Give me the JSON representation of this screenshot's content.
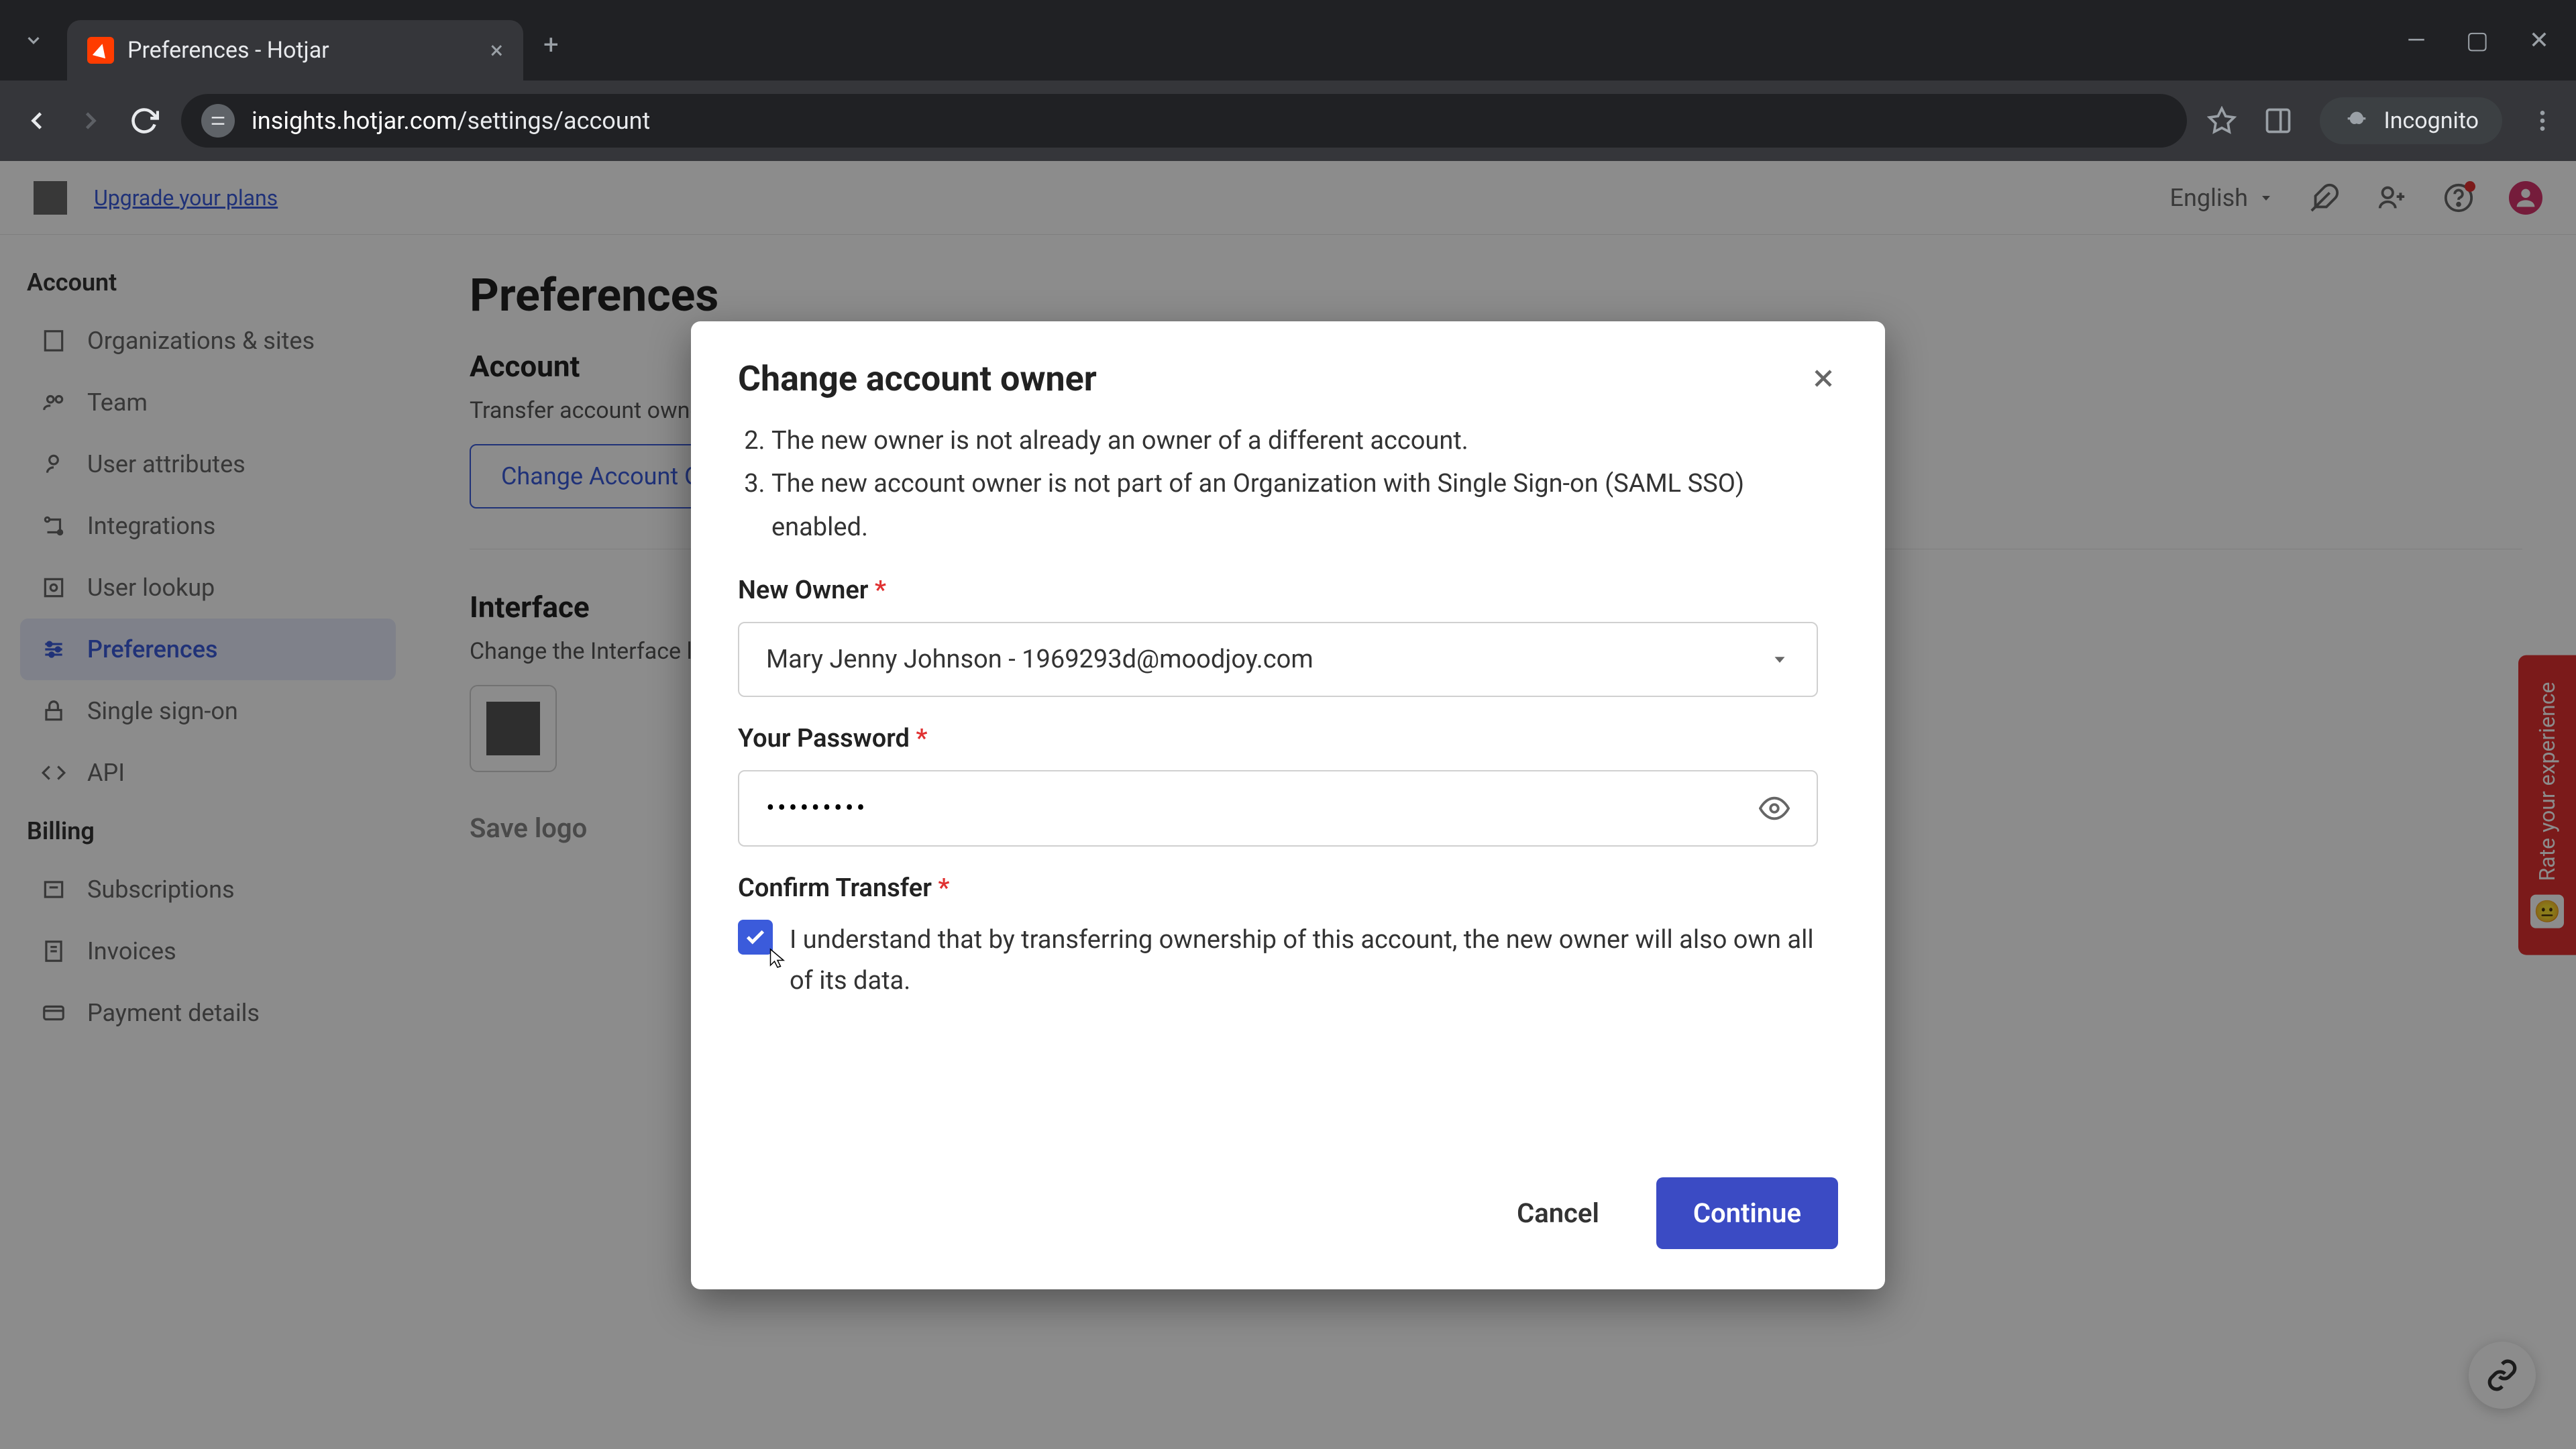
{
  "browser": {
    "tab_title": "Preferences - Hotjar",
    "url_host": "insights.hotjar.com",
    "url_path": "/settings/account",
    "incognito_label": "Incognito"
  },
  "header": {
    "upgrade": "Upgrade your plans",
    "language": "English"
  },
  "sidebar": {
    "section_account": "Account",
    "section_billing": "Billing",
    "items_account": [
      {
        "label": "Organizations & sites"
      },
      {
        "label": "Team"
      },
      {
        "label": "User attributes"
      },
      {
        "label": "Integrations"
      },
      {
        "label": "User lookup"
      },
      {
        "label": "Preferences"
      },
      {
        "label": "Single sign-on"
      },
      {
        "label": "API"
      }
    ],
    "items_billing": [
      {
        "label": "Subscriptions"
      },
      {
        "label": "Invoices"
      },
      {
        "label": "Payment details"
      }
    ]
  },
  "page": {
    "title": "Preferences",
    "account_heading": "Account",
    "account_desc": "Transfer account ownership",
    "change_btn": "Change Account Owner",
    "interface_heading": "Interface",
    "interface_desc": "Change the Interface logo",
    "save_logo": "Save logo"
  },
  "modal": {
    "title": "Change account owner",
    "rule2": "The new owner is not already an owner of a different account.",
    "rule3": "The new account owner is not part of an Organization with Single Sign-on (SAML SSO) enabled.",
    "new_owner_label": "New Owner",
    "new_owner_value": "Mary Jenny Johnson - 1969293d@moodjoy.com",
    "password_label": "Your Password",
    "password_value": "•••••••••",
    "confirm_label": "Confirm Transfer",
    "confirm_text": "I understand that by transferring ownership of this account, the new owner will also own all of its data.",
    "cancel": "Cancel",
    "continue": "Continue"
  },
  "feedback": {
    "label": "Rate your experience"
  }
}
